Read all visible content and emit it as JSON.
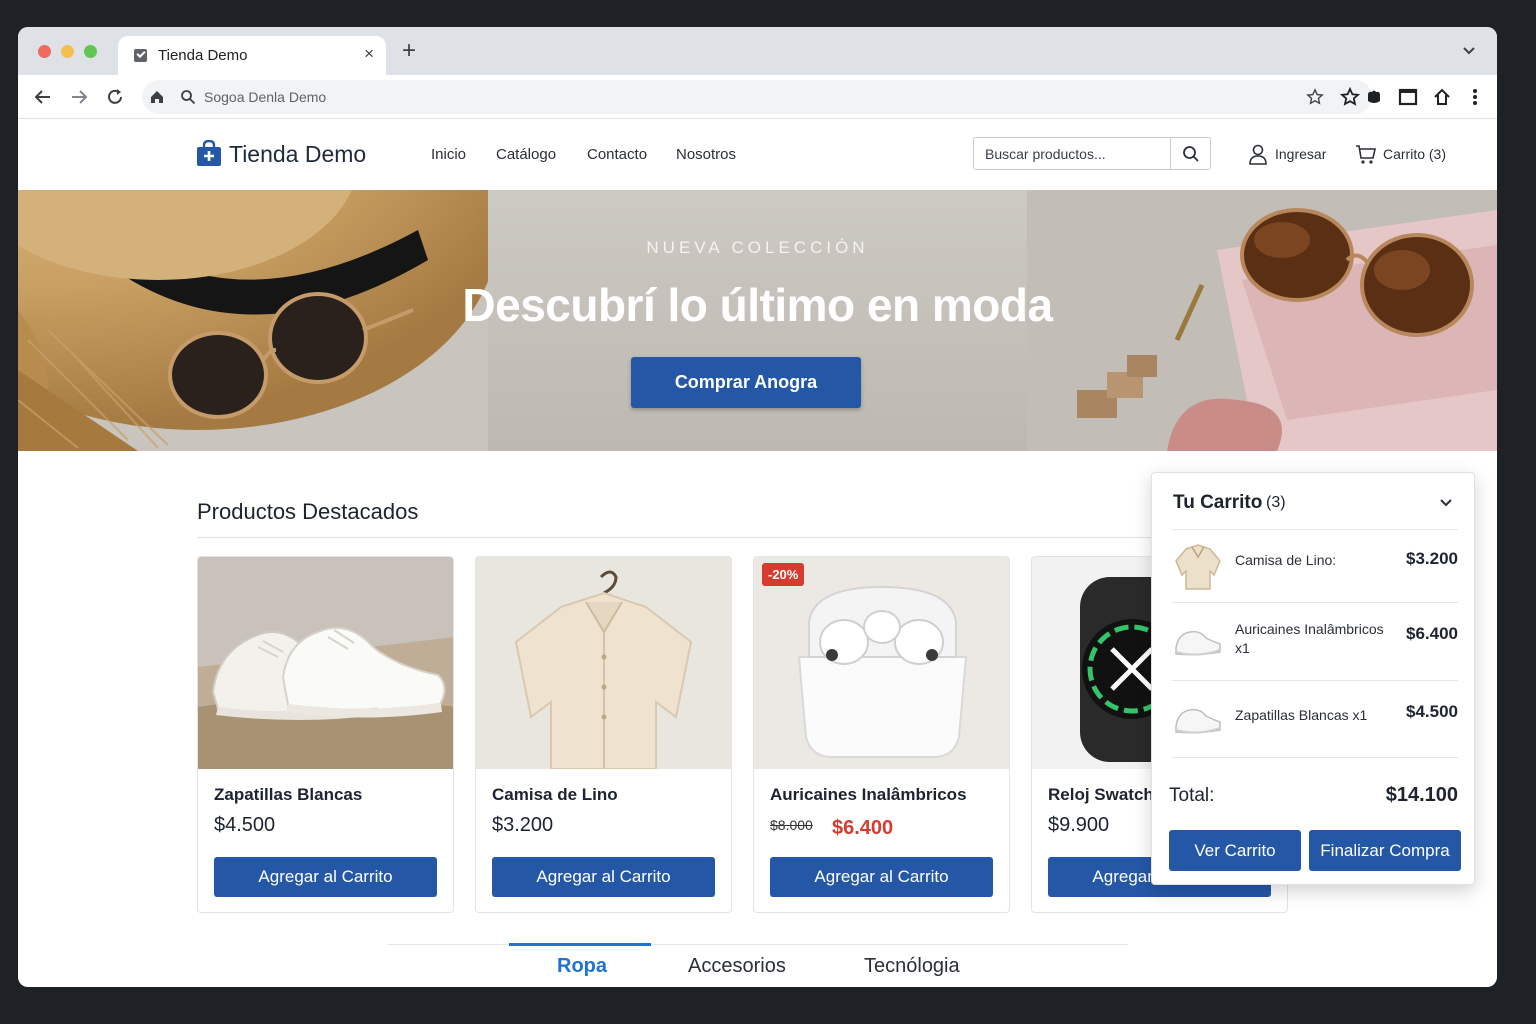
{
  "browser": {
    "tab_title": "Tienda Demo",
    "tab_close": "×",
    "new_tab": "+",
    "address_placeholder": "Sogoa Denla Demo"
  },
  "site": {
    "logo": "Tienda Demo",
    "nav": [
      "Inicio",
      "Catálogo",
      "Contacto",
      "Nosotros"
    ],
    "search_placeholder": "Buscar productos...",
    "login_label": "Ingresar",
    "cart_label": "Carrito (3)"
  },
  "hero": {
    "kicker": "NUEVA COLECCIÓN",
    "title": "Descubrí lo último en moda",
    "cta": "Comprar Anogra"
  },
  "products": {
    "section_title": "Productos Destacados",
    "add_label": "Agregar al Carrito",
    "items": [
      {
        "name": "Zapatillas Blancas",
        "price": "$4.500"
      },
      {
        "name": "Camisa de Lino",
        "price": "$3.200"
      },
      {
        "name": "Auricaines Inalâmbricos",
        "old_price": "$8.000",
        "price": "$6.400",
        "badge": "-20%"
      },
      {
        "name": "Reloj Swatch",
        "price": "$9.900"
      }
    ]
  },
  "categories": {
    "tabs": [
      "Ropa",
      "Accesorios",
      "Tecnólogia"
    ],
    "active": "Ropa"
  },
  "cart": {
    "title": "Tu Carrito",
    "count": "(3)",
    "items": [
      {
        "name": "Camisa de Lino:",
        "price": "$3.200"
      },
      {
        "name": "Auricaines Inalâmbricos  x1",
        "price": "$6.400"
      },
      {
        "name": "Zapatillas Blancas  x1",
        "price": "$4.500"
      }
    ],
    "total_label": "Total:",
    "total_value": "$14.100",
    "view_button": "Ver Carrito",
    "checkout_button": "Finalizar Compra"
  },
  "colors": {
    "primary": "#2458a7",
    "accent_blue": "#1f73d3",
    "sale_red": "#d63b2f"
  }
}
